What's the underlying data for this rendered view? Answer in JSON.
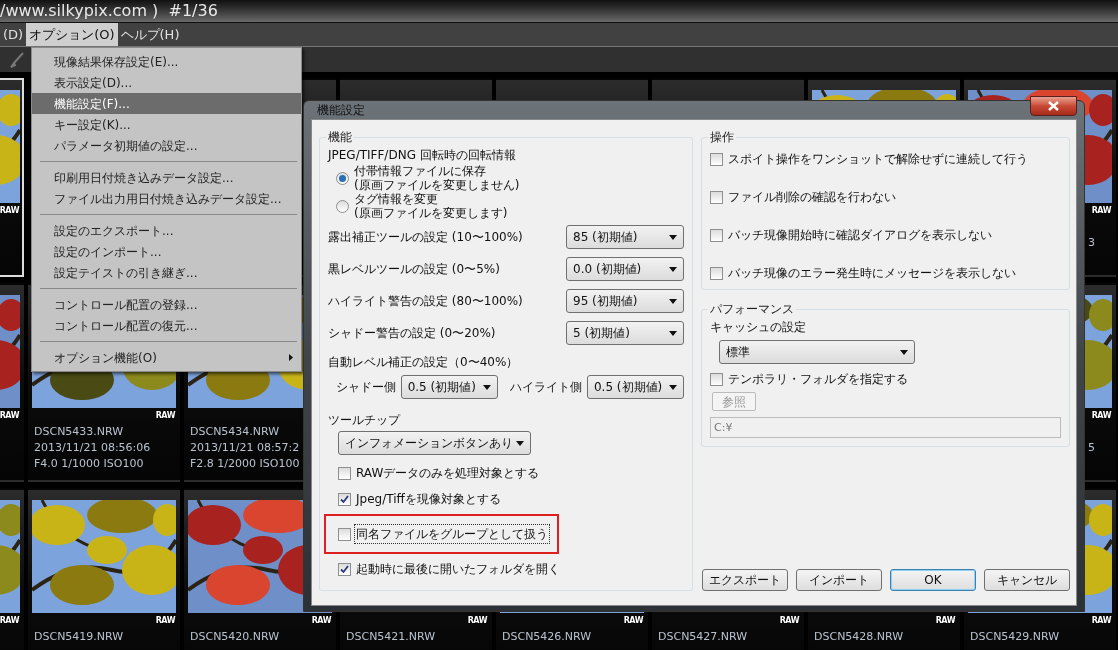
{
  "window": {
    "title": "/www.silkypix.com )  #1/36"
  },
  "menu_bar": [
    {
      "label": "(D)",
      "selected": false
    },
    {
      "label": "オプション(O)",
      "selected": true
    },
    {
      "label": "ヘルプ(H)",
      "selected": false
    }
  ],
  "options_menu": [
    {
      "kind": "item",
      "label": "現像結果保存設定(E)...",
      "selected": false,
      "submenu": false
    },
    {
      "kind": "item",
      "label": "表示設定(D)...",
      "selected": false,
      "submenu": false
    },
    {
      "kind": "item",
      "label": "機能設定(F)...",
      "selected": true,
      "submenu": false
    },
    {
      "kind": "item",
      "label": "キー設定(K)...",
      "selected": false,
      "submenu": false
    },
    {
      "kind": "item",
      "label": "パラメータ初期値の設定...",
      "selected": false,
      "submenu": false
    },
    {
      "kind": "separator"
    },
    {
      "kind": "item",
      "label": "印刷用日付焼き込みデータ設定...",
      "selected": false,
      "submenu": false
    },
    {
      "kind": "item",
      "label": "ファイル出力用日付焼き込みデータ設定...",
      "selected": false,
      "submenu": false
    },
    {
      "kind": "separator"
    },
    {
      "kind": "item",
      "label": "設定のエクスポート...",
      "selected": false,
      "submenu": false
    },
    {
      "kind": "item",
      "label": "設定のインポート...",
      "selected": false,
      "submenu": false
    },
    {
      "kind": "item",
      "label": "設定テイストの引き継ぎ...",
      "selected": false,
      "submenu": false
    },
    {
      "kind": "separator"
    },
    {
      "kind": "item",
      "label": "コントロール配置の登録...",
      "selected": false,
      "submenu": false
    },
    {
      "kind": "item",
      "label": "コントロール配置の復元...",
      "selected": false,
      "submenu": false
    },
    {
      "kind": "separator"
    },
    {
      "kind": "item",
      "label": "オプション機能(O)",
      "selected": false,
      "submenu": true
    }
  ],
  "thumbnails": [
    [
      {
        "kind": "thumbnail",
        "picture": true,
        "badge": "RAW",
        "selected": true
      },
      {
        "kind": "hidden"
      },
      {
        "kind": "thumbnail",
        "selected": false
      },
      {
        "kind": "thumbnail",
        "selected": false
      },
      {
        "kind": "thumbnail",
        "selected": false
      },
      {
        "kind": "thumbnail",
        "selected": false
      },
      {
        "kind": "thumbnail",
        "picture": true,
        "selected": false
      },
      {
        "kind": "thumbnail",
        "picture": true,
        "badge": "RAW",
        "date_tail": "3",
        "selected": false
      }
    ],
    [
      {
        "kind": "thumbnail",
        "picture": true,
        "badge": "RAW",
        "selected": false
      },
      {
        "kind": "thumbnail",
        "picture": true,
        "badge": "RAW",
        "name": "DSCN5433.NRW",
        "date": "2013/11/21 08:56:06",
        "exposure": "F4.0 1/1000 ISO100",
        "selected": false
      },
      {
        "kind": "thumbnail",
        "picture": true,
        "name": "DSCN5434.NRW",
        "date": "2013/11/21 08:57:2",
        "exposure": "F2.8 1/2000 ISO100",
        "selected": false
      },
      {
        "kind": "hidden"
      },
      {
        "kind": "hidden"
      },
      {
        "kind": "hidden"
      },
      {
        "kind": "hidden"
      },
      {
        "kind": "thumbnail",
        "picture": true,
        "badge": "RAW",
        "date_tail": "5",
        "selected": false
      }
    ],
    [
      {
        "kind": "thumbnail",
        "picture": true,
        "badge": "RAW",
        "selected": false
      },
      {
        "kind": "thumbnail",
        "picture": true,
        "badge": "RAW",
        "name": "DSCN5419.NRW",
        "selected": false
      },
      {
        "kind": "thumbnail",
        "picture": true,
        "badge": "RAW",
        "name": "DSCN5420.NRW",
        "selected": false
      },
      {
        "kind": "thumbnail",
        "badge": "RAW",
        "name": "DSCN5421.NRW",
        "selected": false
      },
      {
        "kind": "thumbnail",
        "picture": true,
        "badge": "RAW",
        "name": "DSCN5426.NRW",
        "selected": false
      },
      {
        "kind": "thumbnail",
        "badge": "RAW",
        "name": "DSCN5427.NRW",
        "selected": false
      },
      {
        "kind": "thumbnail",
        "badge": "RAW",
        "name": "DSCN5428.NRW",
        "selected": false
      },
      {
        "kind": "thumbnail",
        "picture": true,
        "badge": "RAW",
        "name": "DSCN5429.NRW",
        "selected": false
      }
    ]
  ],
  "dialog": {
    "title": "機能設定",
    "function_group": {
      "legend": "機能",
      "rotation_label": "JPEG/TIFF/DNG 回転時の回転情報",
      "rotation_options": [
        {
          "label": "付帯情報ファイルに保存",
          "note": "(原画ファイルを変更しません)",
          "selected": true
        },
        {
          "label": "タグ情報を変更",
          "note": "(原画ファイルを変更します)",
          "selected": false
        }
      ],
      "tool_settings": [
        {
          "label": "露出補正ツールの設定 (10〜100%)",
          "value": "85 (初期値)"
        },
        {
          "label": "黒レベルツールの設定 (0〜5%)",
          "value": "0.0 (初期値)"
        },
        {
          "label": "ハイライト警告の設定 (80〜100%)",
          "value": "95 (初期値)"
        },
        {
          "label": "シャドー警告の設定 (0〜20%)",
          "value": "5 (初期値)"
        }
      ],
      "auto_level": {
        "label": "自動レベル補正の設定（0〜40%）",
        "shadow_label": "シャドー側",
        "shadow_value": "0.5 (初期値)",
        "highlight_label": "ハイライト側",
        "highlight_value": "0.5 (初期値)"
      },
      "tooltip": {
        "label": "ツールチップ",
        "value": "インフォメーションボタンあり"
      },
      "options": [
        {
          "label": "RAWデータのみを処理対象とする",
          "checked": false,
          "focused": false,
          "highlighted": false
        },
        {
          "label": "Jpeg/Tiffを現像対象とする",
          "checked": true,
          "focused": false,
          "highlighted": false
        },
        {
          "label": "同名ファイルをグループとして扱う",
          "checked": false,
          "focused": true,
          "highlighted": true
        },
        {
          "label": "起動時に最後に開いたフォルダを開く",
          "checked": true,
          "focused": false,
          "highlighted": false
        }
      ]
    },
    "operation_group": {
      "legend": "操作",
      "options": [
        {
          "label": "スポイト操作をワンショットで解除せずに連続して行う",
          "checked": false
        },
        {
          "label": "ファイル削除の確認を行わない",
          "checked": false
        },
        {
          "label": "バッチ現像開始時に確認ダイアログを表示しない",
          "checked": false
        },
        {
          "label": "バッチ現像のエラー発生時にメッセージを表示しない",
          "checked": false
        }
      ]
    },
    "performance_group": {
      "legend": "パフォーマンス",
      "cache_label": "キャッシュの設定",
      "cache_value": "標準",
      "temp_folder": {
        "label": "テンポラリ・フォルダを指定する",
        "checked": false
      },
      "browse_button": {
        "label": "参照",
        "disabled": true
      },
      "path": {
        "value": "C:¥",
        "disabled": true
      }
    },
    "buttons": [
      {
        "label": "エクスポート",
        "default": false
      },
      {
        "label": "インポート",
        "default": false
      },
      {
        "label": "OK",
        "default": true
      },
      {
        "label": "キャンセル",
        "default": false
      }
    ]
  }
}
